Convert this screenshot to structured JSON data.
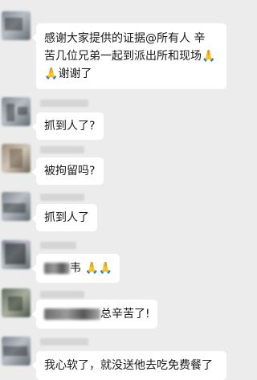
{
  "messages": [
    {
      "text_line1": "感谢大家提供的证据@所有人  辛",
      "text_line2": "苦几位兄弟一起到派出所和现场",
      "emoji_a": "🙏",
      "text_line3": "谢谢了",
      "emoji_b": "🙏"
    },
    {
      "text": "抓到人了?"
    },
    {
      "text": "被拘留吗?"
    },
    {
      "text": "抓到人了"
    },
    {
      "partial": "韦",
      "emoji": "🙏🙏"
    },
    {
      "partial": "总辛苦了!"
    },
    {
      "text": "我心软了，就没送他去吃免费餐了"
    }
  ]
}
